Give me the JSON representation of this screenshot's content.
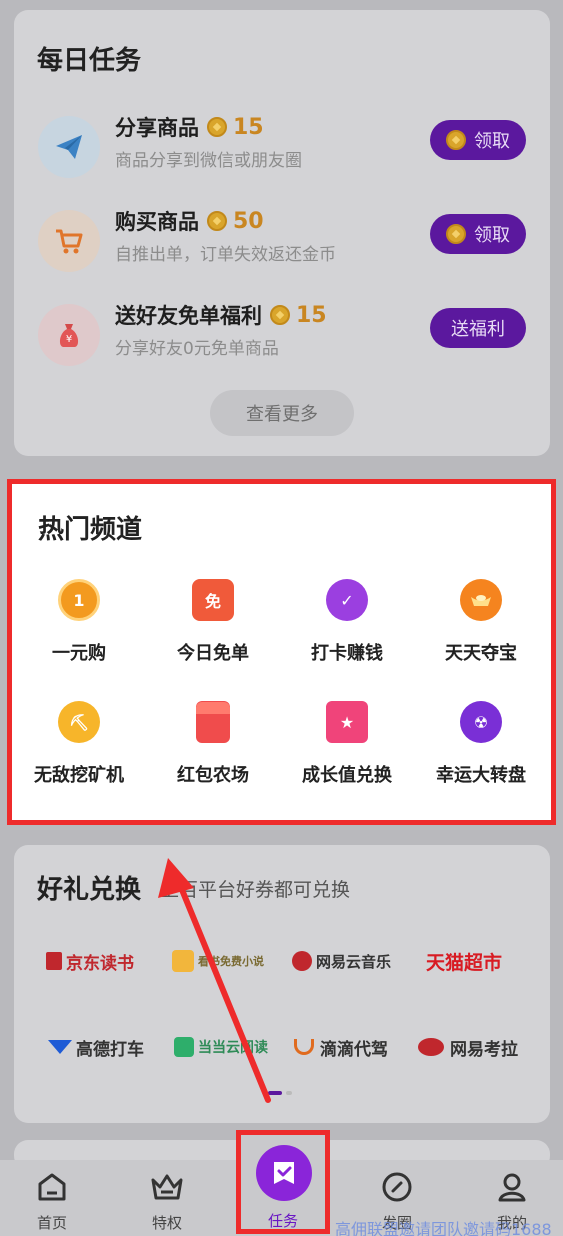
{
  "status_bar_text": "",
  "daily_tasks": {
    "title": "每日任务",
    "tasks": [
      {
        "name": "分享商品",
        "reward": "15",
        "desc": "商品分享到微信或朋友圈",
        "button": "领取"
      },
      {
        "name": "购买商品",
        "reward": "50",
        "desc": "自推出单，订单失效返还金币",
        "button": "领取"
      },
      {
        "name": "送好友免单福利",
        "reward": "15",
        "desc": "分享好友0元免单商品",
        "button": "送福利"
      }
    ],
    "more": "查看更多"
  },
  "hot_channels": {
    "title": "热门频道",
    "items": [
      {
        "label": "一元购",
        "icon": "one-yuan-icon",
        "glyph": "1"
      },
      {
        "label": "今日免单",
        "icon": "free-order-icon",
        "glyph": "免"
      },
      {
        "label": "打卡赚钱",
        "icon": "alarm-clock-icon",
        "glyph": "✓"
      },
      {
        "label": "天天夺宝",
        "icon": "ingot-icon",
        "glyph": ""
      },
      {
        "label": "无敌挖矿机",
        "icon": "pickaxe-icon",
        "glyph": "⛏"
      },
      {
        "label": "红包农场",
        "icon": "red-envelope-icon",
        "glyph": ""
      },
      {
        "label": "成长值兑换",
        "icon": "star-icon",
        "glyph": "★"
      },
      {
        "label": "幸运大转盘",
        "icon": "wheel-icon",
        "glyph": "☢"
      }
    ]
  },
  "gift_exchange": {
    "title": "好礼兑换",
    "subtitle": "上百平台好券都可兑换",
    "brands": [
      {
        "name": "京东读书",
        "color": "#c0272d"
      },
      {
        "name": "看书免费小说",
        "color": "#7a6a32"
      },
      {
        "name": "网易云音乐",
        "color": "#c0272d"
      },
      {
        "name": "天猫超市",
        "color": "#d81b23"
      },
      {
        "name": "高德打车",
        "color": "#1e5bd6"
      },
      {
        "name": "当当云阅读",
        "color": "#2e8b57"
      },
      {
        "name": "滴滴代驾",
        "color": "#e06b1f"
      },
      {
        "name": "网易考拉",
        "color": "#c0272d"
      }
    ]
  },
  "tabs": [
    {
      "label": "首页",
      "icon": "home-icon"
    },
    {
      "label": "特权",
      "icon": "crown-icon"
    },
    {
      "label": "任务",
      "icon": "task-icon"
    },
    {
      "label": "发圈",
      "icon": "compass-icon"
    },
    {
      "label": "我的",
      "icon": "user-icon"
    }
  ],
  "watermark": "高佣联盟邀请团队邀请码1688",
  "colors": {
    "accent": "#5b189e",
    "highlight_border": "#ee2b2b",
    "coin": "#d9a52b"
  }
}
